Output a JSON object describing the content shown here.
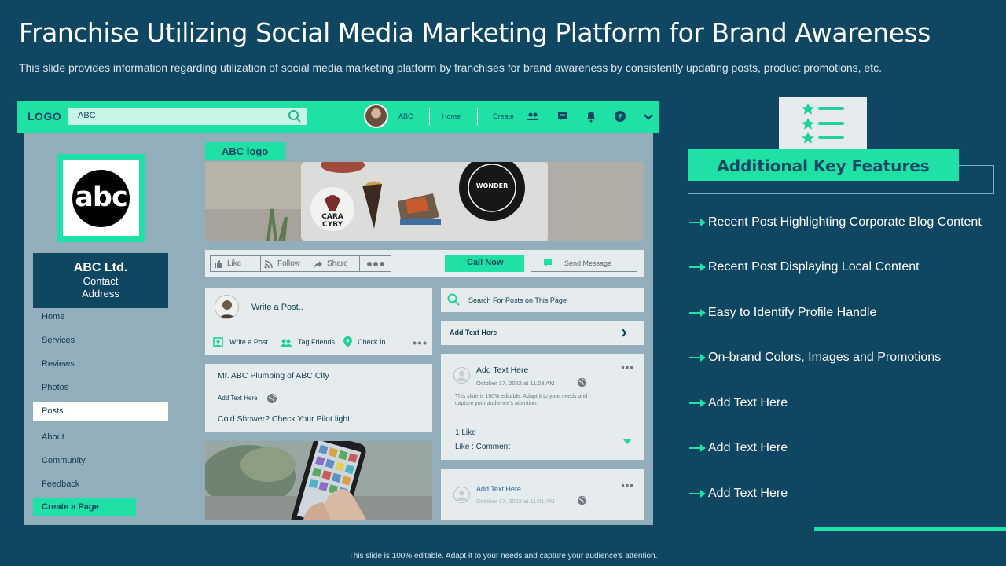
{
  "slide": {
    "title": "Franchise Utilizing Social Media Marketing Platform for Brand Awareness",
    "subtitle": "This slide provides information regarding utilization of social media marketing platform by franchises for brand awareness by consistently updating posts, product promotions, etc.",
    "footer": "This slide is 100% editable. Adapt it to your needs and capture your audience's attention."
  },
  "colors": {
    "background": "#0f4762",
    "accent": "#1fe0a5",
    "card": "#e6ecee",
    "panel": "#93aebb"
  },
  "topbar": {
    "logo": "LOGO",
    "search_value": "ABC",
    "user_name": "ABC",
    "home": "Home",
    "create": "Create",
    "icons": [
      "search-icon",
      "friends-icon",
      "messenger-icon",
      "bell-icon",
      "help-icon",
      "chevron-down-icon"
    ]
  },
  "profile": {
    "avatar_text": "abc",
    "company_name": "ABC Ltd.",
    "contact": "Contact",
    "address": "Address",
    "nav": [
      "Home",
      "Services",
      "Reviews",
      "Photos",
      "Posts",
      "About",
      "Community",
      "Feedback"
    ],
    "active_nav": "Posts",
    "create_page": "Create a Page"
  },
  "page": {
    "logo_tag": "ABC logo",
    "actions": {
      "like": "Like",
      "follow": "Follow",
      "share": "Share",
      "call_now": "Call Now",
      "send_message": "Send Message"
    }
  },
  "composer": {
    "placeholder": "Write a Post..",
    "write_post": "Write a Post..",
    "tag_friends": "Tag Friends",
    "check_in": "Check In"
  },
  "post": {
    "author": "Mr. ABC Plumbing  of ABC City",
    "meta": "Add Text Here",
    "body": "Cold Shower? Check Your Pilot light!"
  },
  "side": {
    "search_placeholder": "Search For Posts on This Page",
    "add_text_bar": "Add Text Here",
    "card1": {
      "title": "Add Text Here",
      "date": "October  17, 2022 at 11:03 AM",
      "body1": "This slide is 100% editable.  Adapt it to your needs and",
      "body2": "capture your audience's attention.",
      "likes": "1 Like",
      "like_comment": "Like : Comment"
    },
    "card2": {
      "title": "Add Text Here",
      "date": "October  17, 2022 at 11:01 AM"
    }
  },
  "features": {
    "header": "Additional Key Features",
    "items": [
      "Recent Post Highlighting  Corporate Blog Content",
      "Recent Post Displaying Local Content",
      "Easy to Identify  Profile Handle",
      "On-brand Colors, Images and Promotions",
      "Add Text Here",
      "Add Text Here",
      "Add Text Here"
    ]
  }
}
